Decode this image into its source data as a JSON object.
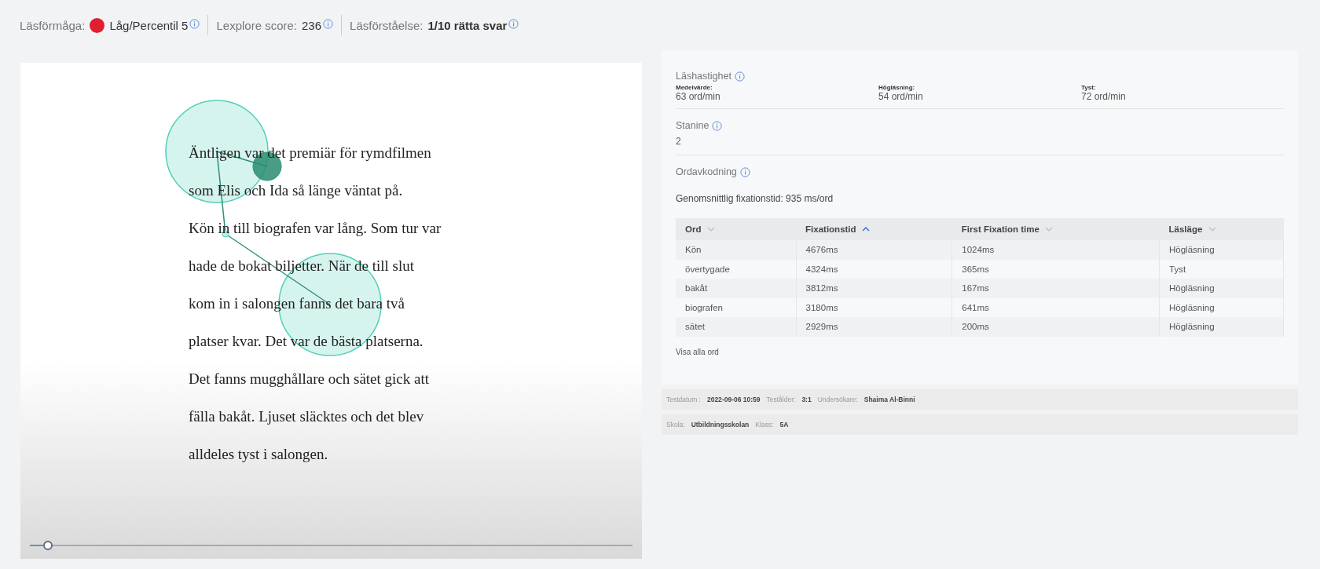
{
  "summary": [
    {
      "label": "Läsförmåga:",
      "value": "Låg/Percentil 5",
      "color": "#e0202e",
      "bold": false
    },
    {
      "label": "Lexplore score:",
      "value": "236",
      "bold": false
    },
    {
      "label": "Läsförståelse:",
      "value": "1/10 rätta svar",
      "bold": true
    }
  ],
  "reading": {
    "lines": [
      "Äntligen var det premiär för rymdfilmen",
      "som Elis och Ida så länge väntat på.",
      "Kön in till biografen var lång. Som tur var",
      "hade de bokat biljetter. När de till slut",
      "kom in i salongen fanns det bara två",
      "platser kvar. Det var de bästa platserna.",
      "Det fanns mugghållare och sätet gick att",
      "fälla bakåt. Ljuset släcktes och det blev",
      "alldeles tyst i salongen."
    ],
    "timeline": {
      "level": 0.03
    }
  },
  "speed": {
    "title": "Läshastighet",
    "items": [
      {
        "label": "Medelvärde:",
        "value": "63 ord/min"
      },
      {
        "label": "Högläsning:",
        "value": "54 ord/min"
      },
      {
        "label": "Tyst:",
        "value": "72 ord/min"
      }
    ]
  },
  "stanine": {
    "title": "Stanine",
    "value": "2"
  },
  "decoding": {
    "title": "Ordavkodning",
    "average": "Genomsnittlig fixationstid: 935 ms/ord",
    "columns": [
      {
        "label": "Ord",
        "sorted": false
      },
      {
        "label": "Fixationstid",
        "sorted": true
      },
      {
        "label": "First Fixation time",
        "sorted": false
      },
      {
        "label": "Läsläge",
        "sorted": false
      }
    ],
    "rows": [
      [
        "Kön",
        "4676ms",
        "1024ms",
        "Högläsning"
      ],
      [
        "övertygade",
        "4324ms",
        "365ms",
        "Tyst"
      ],
      [
        "bakåt",
        "3812ms",
        "167ms",
        "Högläsning"
      ],
      [
        "biografen",
        "3180ms",
        "641ms",
        "Högläsning"
      ],
      [
        "sätet",
        "2929ms",
        "200ms",
        "Högläsning"
      ]
    ],
    "show_all": "Visa alla ord"
  },
  "footer": [
    [
      {
        "label": "Testdatum :",
        "value": "2022-09-06 10:59"
      },
      {
        "label": "Testålder:",
        "value": "3:1"
      },
      {
        "label": "Undersökare:",
        "value": "Shaima Al-Binni"
      }
    ],
    [
      {
        "label": "Skola:",
        "value": "Utbildningsskolan"
      },
      {
        "label": "Klass:",
        "value": "5A"
      }
    ]
  ]
}
